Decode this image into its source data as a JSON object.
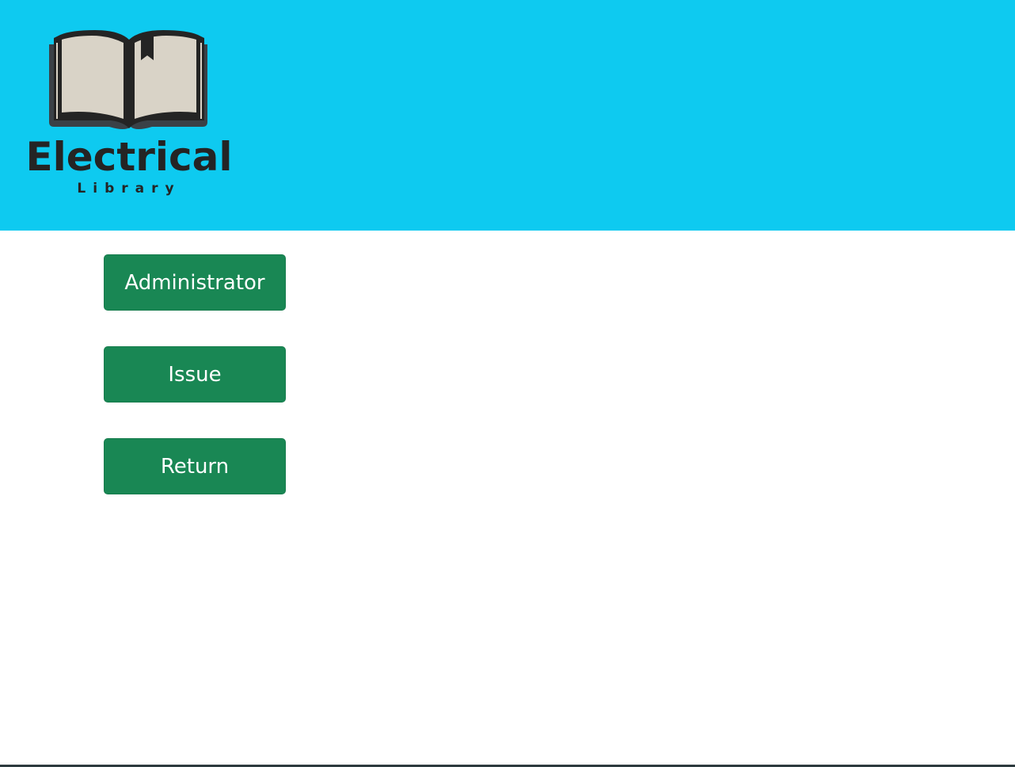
{
  "colors": {
    "header_bg": "#0ecaf0",
    "button_bg": "#198754",
    "button_text": "#ffffff",
    "bottom_border": "#2d3a3e",
    "logo_ink": "#242424",
    "logo_pages": "#d9d3c7"
  },
  "logo": {
    "title": "Electrical",
    "subtitle": "Library",
    "icon": "open-book-icon"
  },
  "menu": {
    "buttons": [
      {
        "label": "Administrator"
      },
      {
        "label": "Issue"
      },
      {
        "label": "Return"
      }
    ]
  }
}
